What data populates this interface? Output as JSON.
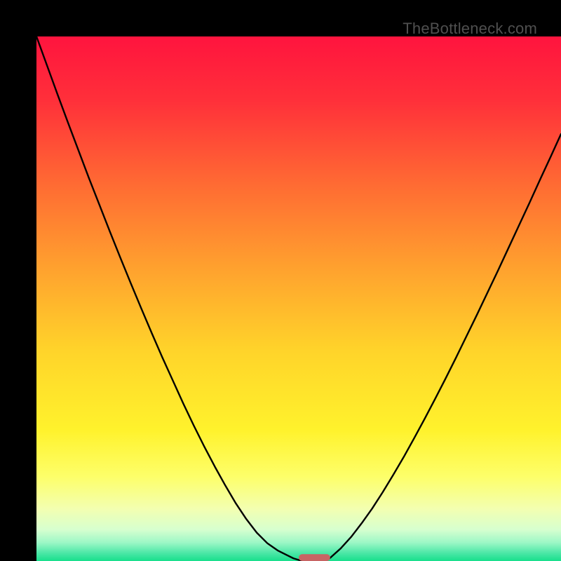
{
  "watermark": "TheBottleneck.com",
  "chart_data": {
    "type": "line",
    "title": "",
    "xlabel": "",
    "ylabel": "",
    "xlim": [
      0,
      100
    ],
    "ylim": [
      0,
      100
    ],
    "background_gradient": {
      "stops": [
        {
          "offset": 0,
          "color": "#ff143e"
        },
        {
          "offset": 0.12,
          "color": "#ff2f3a"
        },
        {
          "offset": 0.28,
          "color": "#ff6a33"
        },
        {
          "offset": 0.45,
          "color": "#ffa42e"
        },
        {
          "offset": 0.6,
          "color": "#ffd42a"
        },
        {
          "offset": 0.75,
          "color": "#fff22c"
        },
        {
          "offset": 0.84,
          "color": "#fdff6a"
        },
        {
          "offset": 0.9,
          "color": "#f3ffb0"
        },
        {
          "offset": 0.94,
          "color": "#d7ffcf"
        },
        {
          "offset": 0.965,
          "color": "#9cf7c6"
        },
        {
          "offset": 0.985,
          "color": "#4be7a6"
        },
        {
          "offset": 1.0,
          "color": "#18df8c"
        }
      ]
    },
    "series": [
      {
        "name": "left-curve",
        "x": [
          0,
          2,
          4,
          6,
          8,
          10,
          12,
          14,
          16,
          18,
          20,
          22,
          24,
          26,
          28,
          30,
          32,
          34,
          36,
          38,
          40,
          42,
          44,
          46,
          48,
          49,
          50,
          51
        ],
        "y": [
          100,
          94.5,
          89.0,
          83.6,
          78.3,
          73.0,
          67.9,
          62.8,
          57.8,
          52.9,
          48.1,
          43.4,
          38.8,
          34.4,
          30.0,
          25.8,
          21.8,
          18.0,
          14.4,
          11.0,
          8.0,
          5.4,
          3.4,
          2.0,
          1.0,
          0.5,
          0.2,
          0.0
        ]
      },
      {
        "name": "right-curve",
        "x": [
          55,
          56,
          58,
          60,
          62,
          64,
          66,
          68,
          70,
          72,
          74,
          76,
          78,
          80,
          82,
          84,
          86,
          88,
          90,
          92,
          94,
          96,
          98,
          100
        ],
        "y": [
          0.0,
          0.6,
          2.4,
          4.6,
          7.2,
          10.0,
          13.1,
          16.4,
          19.8,
          23.4,
          27.1,
          30.9,
          34.8,
          38.8,
          42.9,
          47.0,
          51.2,
          55.4,
          59.7,
          64.0,
          68.3,
          72.7,
          77.0,
          81.4
        ]
      }
    ],
    "marker": {
      "shape": "rounded-bar",
      "color": "#c86464",
      "x_range": [
        50,
        56
      ],
      "y": 0,
      "height": 1.3
    }
  }
}
